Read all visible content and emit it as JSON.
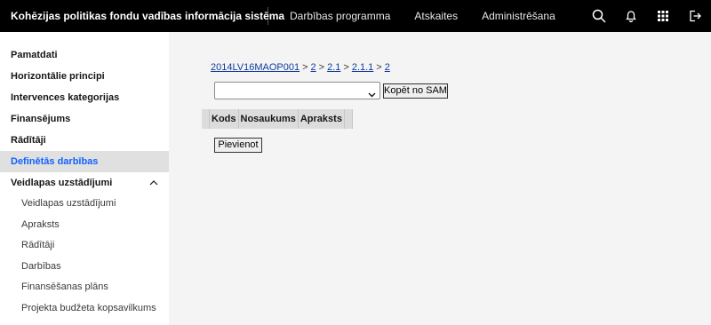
{
  "header": {
    "app_title": "Kohēzijas politikas fondu vadības informācija sistēma",
    "nav": [
      "Darbības programma",
      "Atskaites",
      "Administrēšana"
    ],
    "icons": [
      "search-icon",
      "notification-icon",
      "app-switcher-icon",
      "logout-icon"
    ]
  },
  "sidebar": {
    "items": [
      {
        "label": "Pamatdati"
      },
      {
        "label": "Horizontālie principi"
      },
      {
        "label": "Intervences kategorijas"
      },
      {
        "label": "Finansējums"
      },
      {
        "label": "Rādītāji"
      },
      {
        "label": "Definētās darbības",
        "active": true
      },
      {
        "label": "Veidlapas uzstādījumi",
        "expanded": true
      }
    ],
    "subitems": [
      "Veidlapas uzstādījumi",
      "Apraksts",
      "Rādītāji",
      "Darbības",
      "Finansēšanas plāns",
      "Projekta budžeta kopsavilkums"
    ]
  },
  "main": {
    "breadcrumb": [
      "2014LV16MAOP001",
      "2",
      "2.1",
      "2.1.1",
      "2"
    ],
    "breadcrumb_separator": ">",
    "select_value": "",
    "copy_button": "Kopēt no SAM",
    "table_headers": [
      "",
      "Kods",
      "Nosaukums",
      "Apraksts",
      ""
    ],
    "add_button": "Pievienot"
  },
  "colors": {
    "header_bg": "#000000",
    "sidebar_active_bg": "#e0e0e0",
    "sidebar_active_text": "#0f62fe",
    "main_bg": "#f4f4f4",
    "link": "#0f3c9e"
  }
}
